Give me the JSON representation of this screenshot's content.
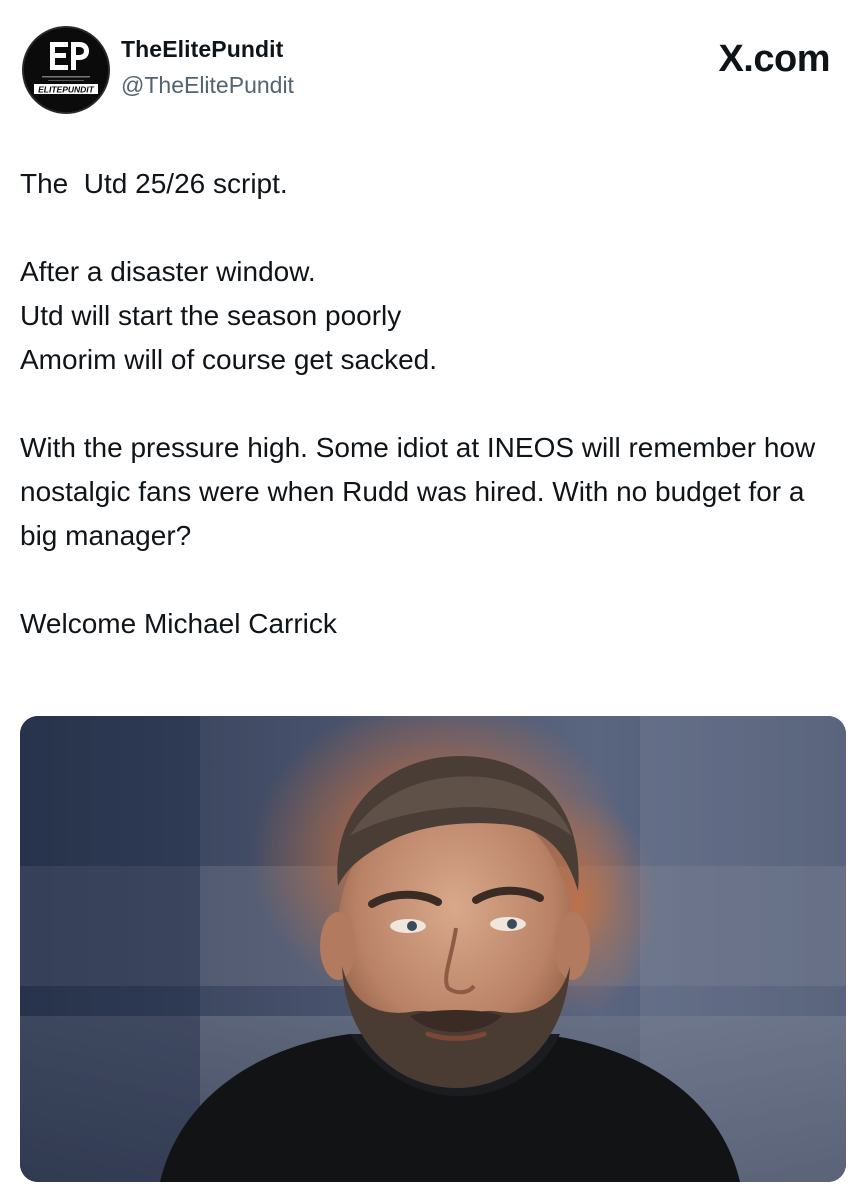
{
  "header": {
    "display_name": "TheElitePundit",
    "handle": "@TheElitePundit",
    "brand": "X.com",
    "avatar": {
      "icon": "elitepundit-logo-icon",
      "logo_monogram": "EP",
      "logo_wordmark": "ELITEPUNDIT"
    }
  },
  "tweet": {
    "paragraphs": [
      "The  Utd 25/26 script.",
      "After a disaster window.\nUtd will start the season poorly\nAmorim will of course get sacked.",
      "With the pressure high. Some idiot at INEOS will remember how nostalgic fans were when Rudd was hired. With no budget for a big manager?",
      "Welcome Michael Carrick"
    ]
  },
  "media": {
    "type": "photo",
    "icon": "portrait-photo"
  },
  "colors": {
    "text_primary": "#0f1419",
    "text_secondary": "#536471",
    "background": "#ffffff"
  }
}
